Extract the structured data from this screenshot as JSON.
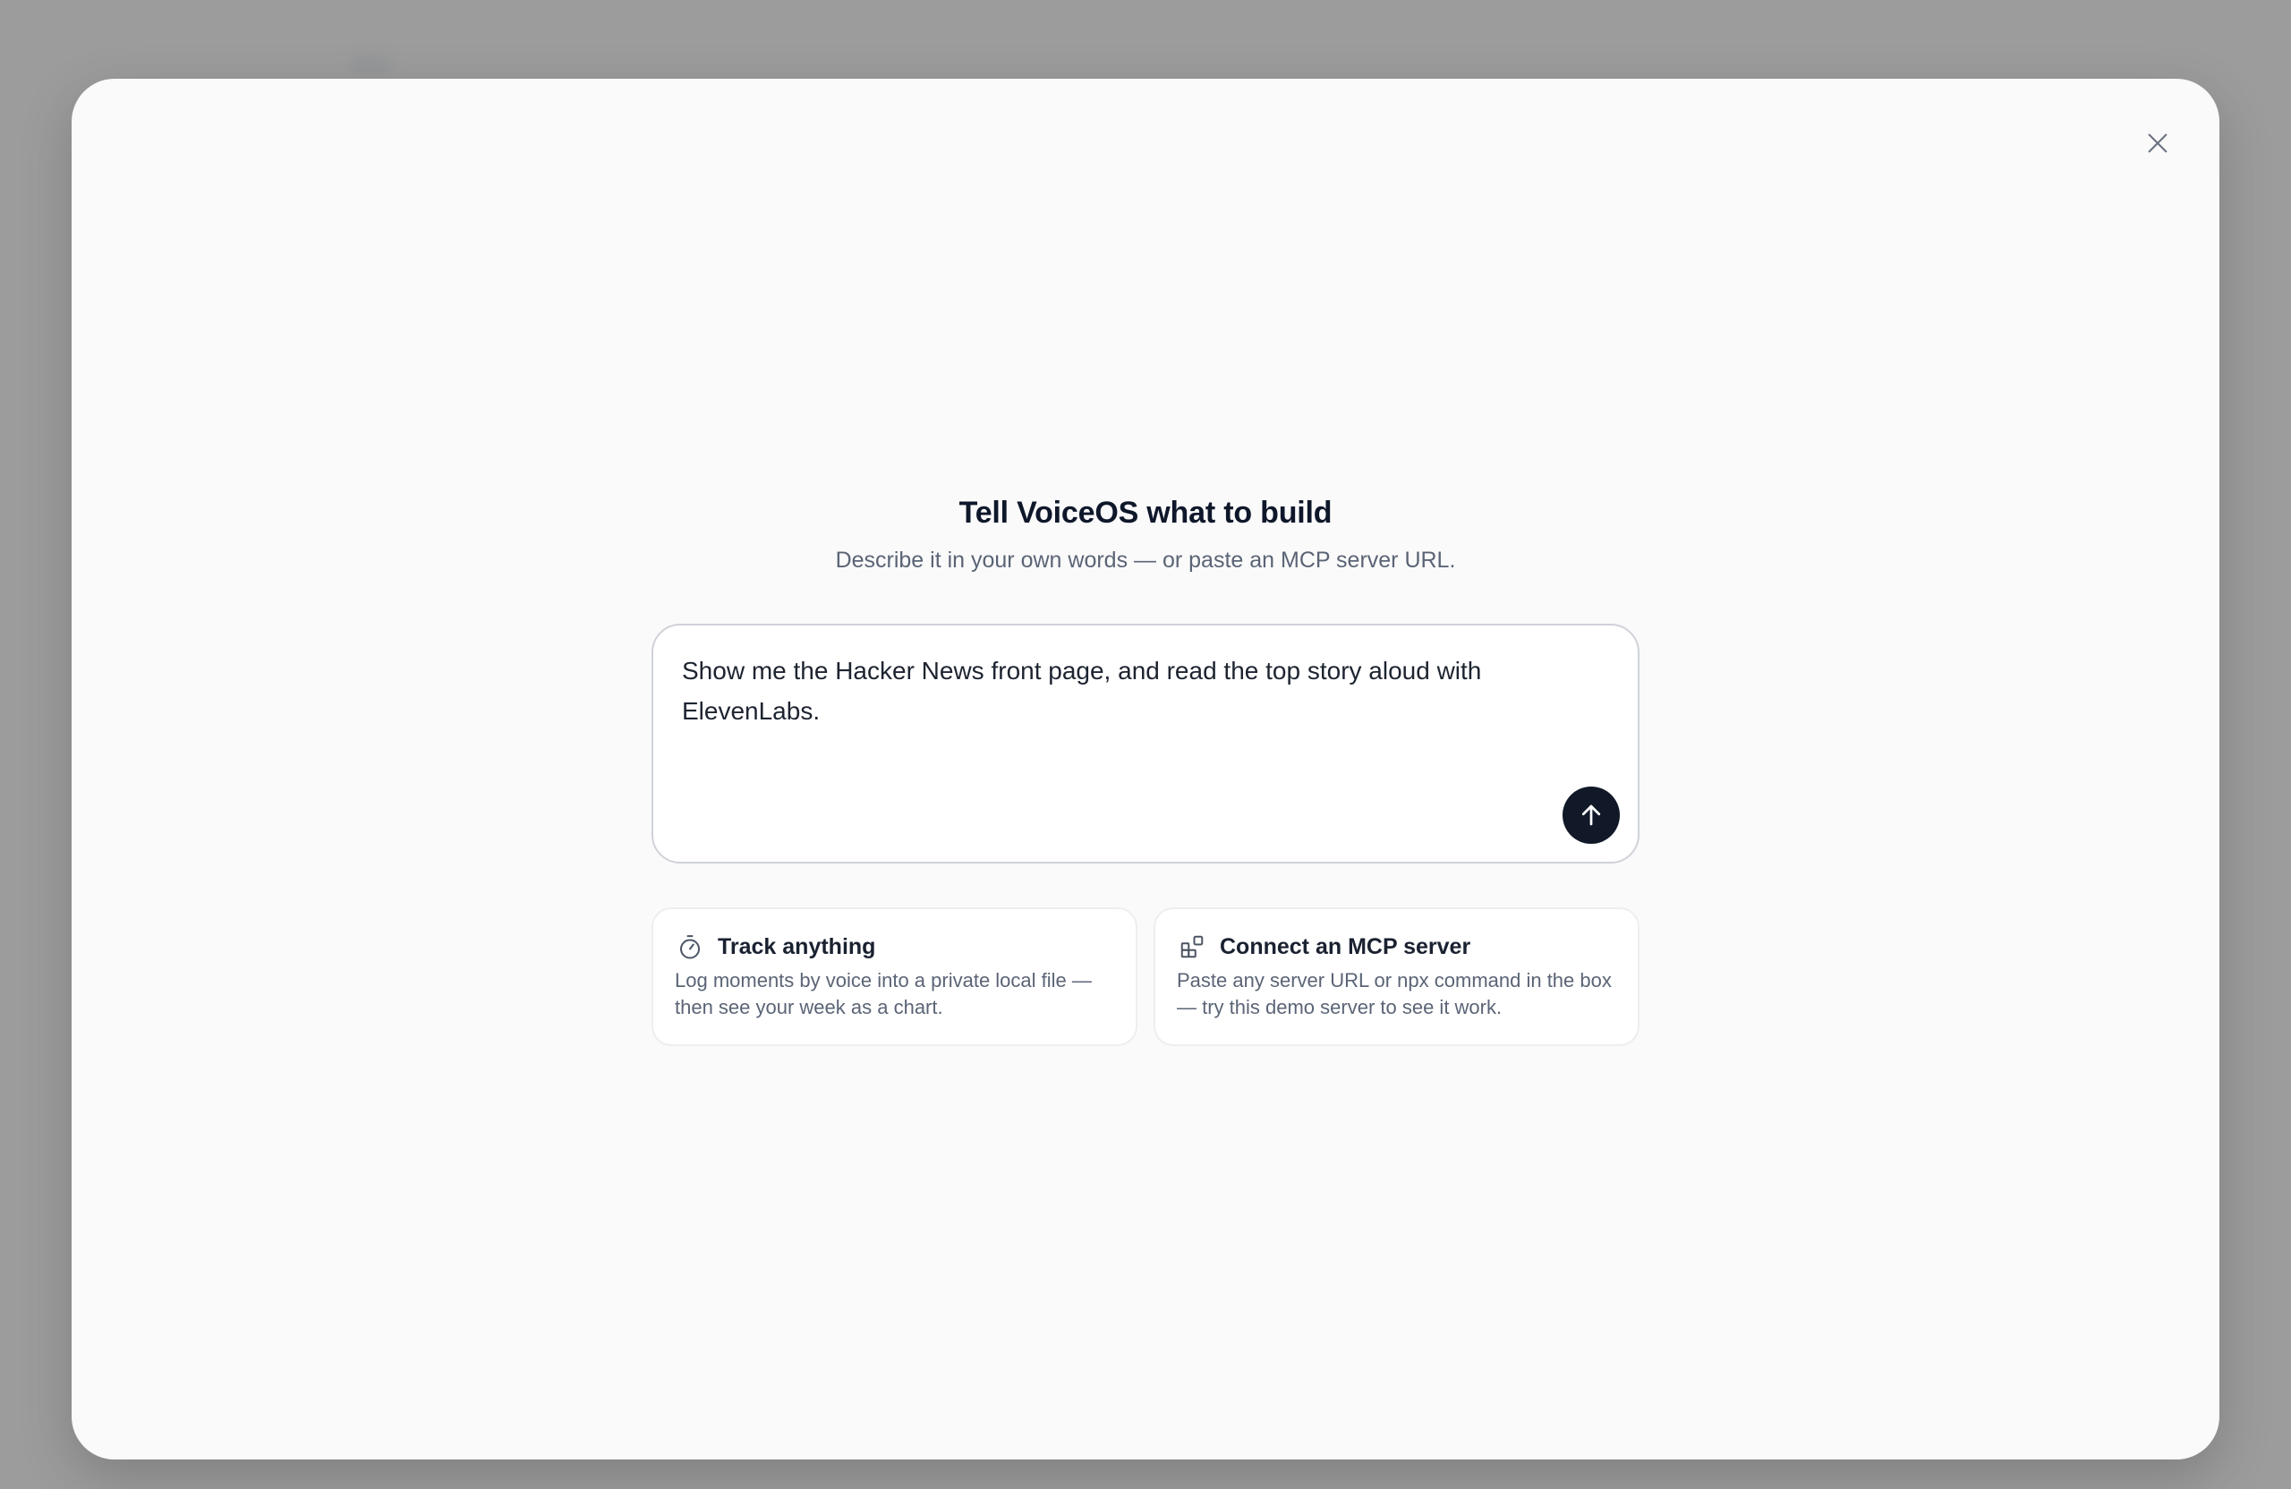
{
  "modal": {
    "close_icon": "close-icon"
  },
  "header": {
    "title": "Tell VoiceOS what to build",
    "subtitle": "Describe it in your own words — or paste an MCP server URL."
  },
  "prompt": {
    "value": "Show me the Hacker News front page, and read the top story aloud with ElevenLabs.",
    "send_icon": "arrow-up-icon"
  },
  "suggestions": [
    {
      "icon": "timer-icon",
      "title": "Track anything",
      "description": "Log moments by voice into a private local file — then see your week as a chart."
    },
    {
      "icon": "blocks-icon",
      "title": "Connect an MCP server",
      "description": "Paste any server URL or npx command in the box — try this demo server to see it work."
    }
  ],
  "colors": {
    "backdrop": "#9c9c9c",
    "modal_bg": "#fafafa",
    "send_button": "#111827",
    "title_text": "#0f172a",
    "muted_text": "#5b6476"
  }
}
